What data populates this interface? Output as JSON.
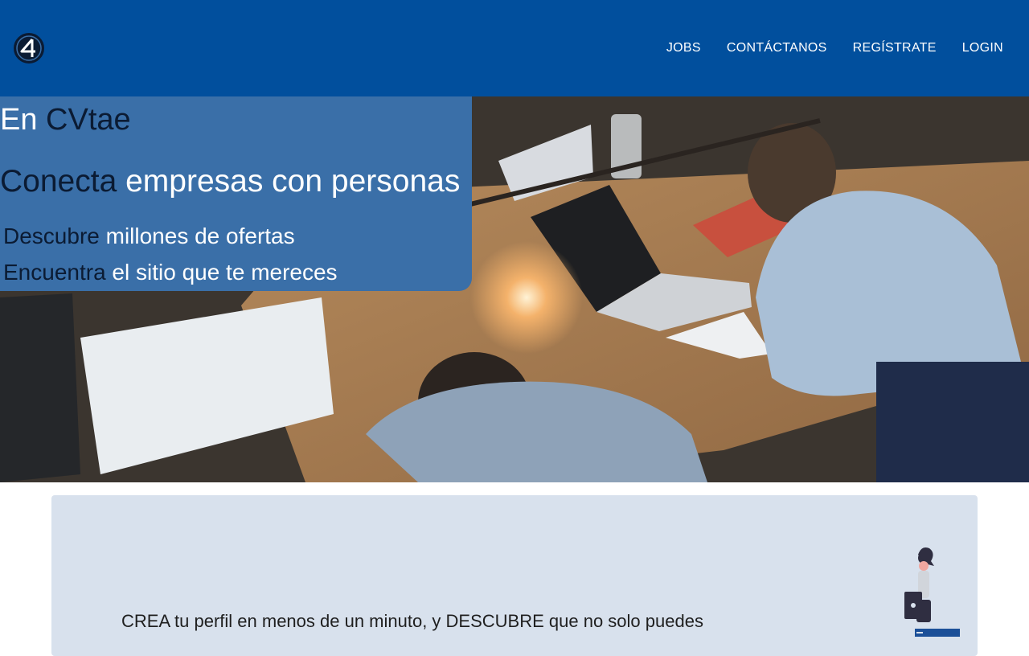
{
  "navbar": {
    "logo_icon": "cvtae-logo-icon",
    "links": [
      "JOBS",
      "CONTÁCTANOS",
      "REGÍSTRATE",
      "LOGIN"
    ]
  },
  "hero": {
    "line1": {
      "a": "En ",
      "b": "CVtae"
    },
    "line2": {
      "a": "Conecta",
      "b": " empresas con personas"
    },
    "line3": {
      "a": "Descubre",
      "b": " millones de ofertas"
    },
    "line4": {
      "a": "Encuentra",
      "b": " el sitio que te mereces"
    }
  },
  "panel": {
    "text": "CREA tu perfil en menos de un minuto, y DESCUBRE que no solo puedes"
  },
  "colors": {
    "navbar": "#014f9d",
    "hero_box": "#3a6fa8",
    "panel": "#d8e1ed",
    "dark_text": "#0b1b33"
  }
}
